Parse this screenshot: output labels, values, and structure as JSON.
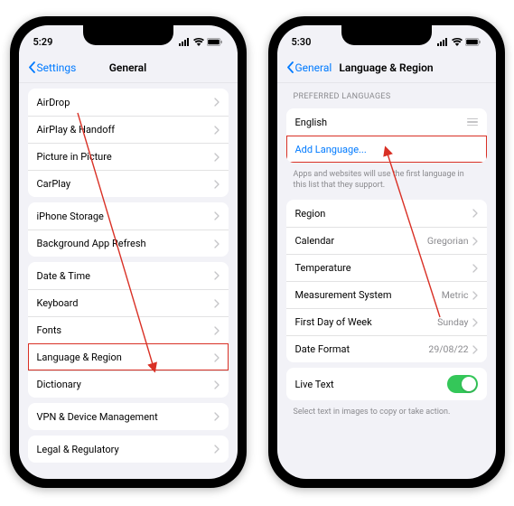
{
  "left": {
    "time": "5:29",
    "back": "Settings",
    "title": "General",
    "g1": [
      "AirDrop",
      "AirPlay & Handoff",
      "Picture in Picture",
      "CarPlay"
    ],
    "g2": [
      "iPhone Storage",
      "Background App Refresh"
    ],
    "g3": [
      "Date & Time",
      "Keyboard",
      "Fonts",
      "Language & Region",
      "Dictionary"
    ],
    "g4": [
      "VPN & Device Management"
    ],
    "g5": [
      "Legal & Regulatory"
    ]
  },
  "right": {
    "time": "5:30",
    "back": "General",
    "title": "Language & Region",
    "pref_header": "Preferred Languages",
    "english": "English",
    "add": "Add Language...",
    "pref_footer": "Apps and websites will use the first language in this list that they support.",
    "rows": [
      {
        "label": "Region",
        "value": ""
      },
      {
        "label": "Calendar",
        "value": "Gregorian"
      },
      {
        "label": "Temperature",
        "value": ""
      },
      {
        "label": "Measurement System",
        "value": "Metric"
      },
      {
        "label": "First Day of Week",
        "value": "Sunday"
      },
      {
        "label": "Date Format",
        "value": "29/08/22"
      }
    ],
    "live_text": "Live Text",
    "live_footer": "Select text in images to copy or take action."
  }
}
